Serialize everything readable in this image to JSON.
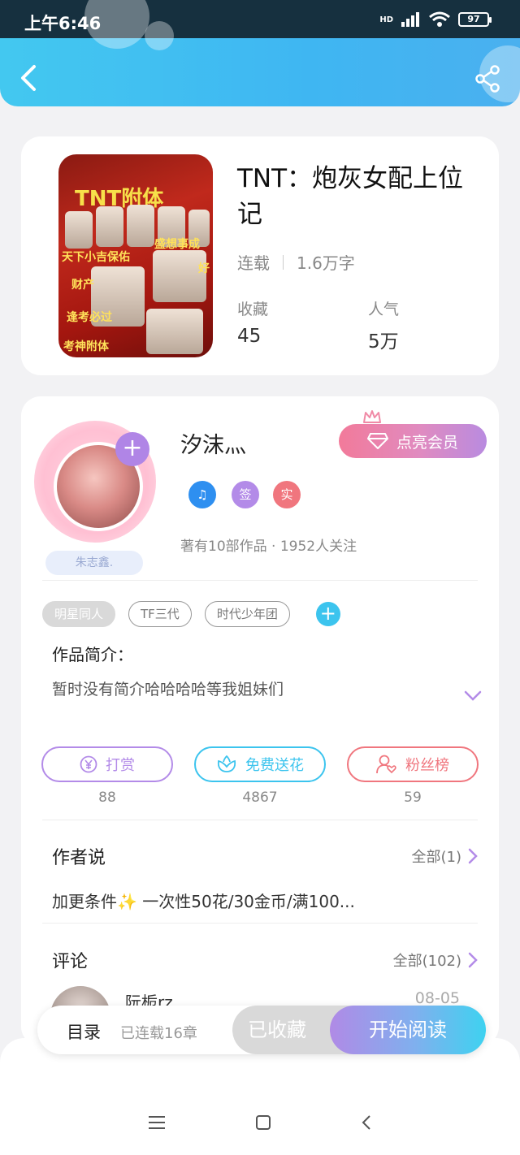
{
  "status_bar": {
    "time": "上午6:46",
    "network": "HD",
    "battery": "97"
  },
  "header": {
    "back_icon": "chevron-left-icon",
    "share_icon": "share-icon"
  },
  "book": {
    "title": "TNT：炮灰女配上位记",
    "status": "连载",
    "word_count": "1.6万字",
    "stats": [
      {
        "label": "收藏",
        "value": "45"
      },
      {
        "label": "人气",
        "value": "5万"
      }
    ],
    "cover": {
      "title": "TNT附体",
      "texts": [
        "天下小吉保佑",
        "财产",
        "逢考必过",
        "考神附体",
        "盛想事成",
        "好"
      ]
    }
  },
  "author": {
    "name": "汐沫灬",
    "vip_button": "点亮会员",
    "badges": [
      {
        "label": "♫",
        "color": "#2e8ff0"
      },
      {
        "label": "签",
        "color": "#b38be8"
      },
      {
        "label": "实",
        "color": "#f0767e"
      }
    ],
    "meta": "著有10部作品 · 1952人关注",
    "avatar_tag": "朱志鑫."
  },
  "tags": [
    "明星同人",
    "TF三代",
    "时代少年团"
  ],
  "intro": {
    "label": "作品简介：",
    "text": "暂时没有简介哈哈哈哈等我姐妹们"
  },
  "actions": [
    {
      "label": "打赏",
      "count": "88",
      "color": "#b38be8",
      "icon": "yen-icon"
    },
    {
      "label": "免费送花",
      "count": "4867",
      "color": "#3cc4ee",
      "icon": "flower-icon"
    },
    {
      "label": "粉丝榜",
      "count": "59",
      "color": "#f0767e",
      "icon": "user-heart-icon"
    }
  ],
  "author_say": {
    "title": "作者说",
    "more": "全部(1)",
    "text": "加更条件✨ 一次性50花/30金币/满100..."
  },
  "comments": {
    "title": "评论",
    "more": "全部(102)",
    "first": {
      "name": "阮栀rz",
      "date": "08-05"
    }
  },
  "bottom_bar": {
    "toc": "目录",
    "toc_sub": "已连载16章",
    "favorited": "已收藏",
    "read": "开始阅读"
  },
  "colors": {
    "header": "#43c8f0",
    "accent_purple": "#b38be8",
    "accent_cyan": "#3cc4ee",
    "accent_red": "#f0767e"
  }
}
